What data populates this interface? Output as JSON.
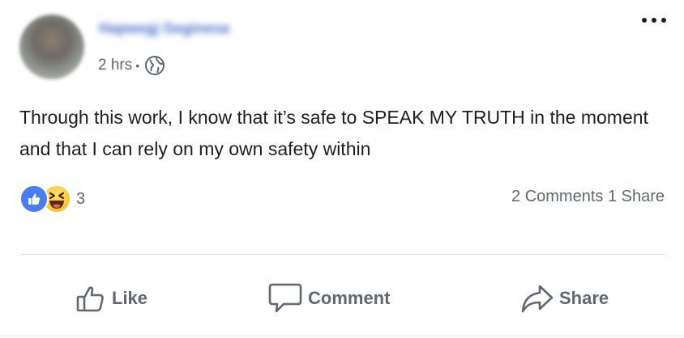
{
  "post": {
    "author_name": "Hapwegj Gegineoa",
    "time": "2 hrs",
    "separator": "•",
    "text": "Through this work, I know that it’s safe to SPEAK MY TRUTH in the moment and that I can rely on my own safety within"
  },
  "reactions": {
    "types": [
      "like",
      "haha"
    ],
    "count": "3",
    "comments_shares": "2 Comments 1 Share"
  },
  "actions": {
    "like_label": "Like",
    "comment_label": "Comment",
    "share_label": "Share"
  },
  "icons": {
    "privacy": "globe-icon",
    "menu": "more-options-icon",
    "like": "thumbs-up-icon",
    "comment": "speech-bubble-icon",
    "share": "share-arrow-icon"
  },
  "colors": {
    "like_blue": "#4a7cf4",
    "haha_yellow": "#f9c531",
    "secondary_text": "#616770"
  }
}
